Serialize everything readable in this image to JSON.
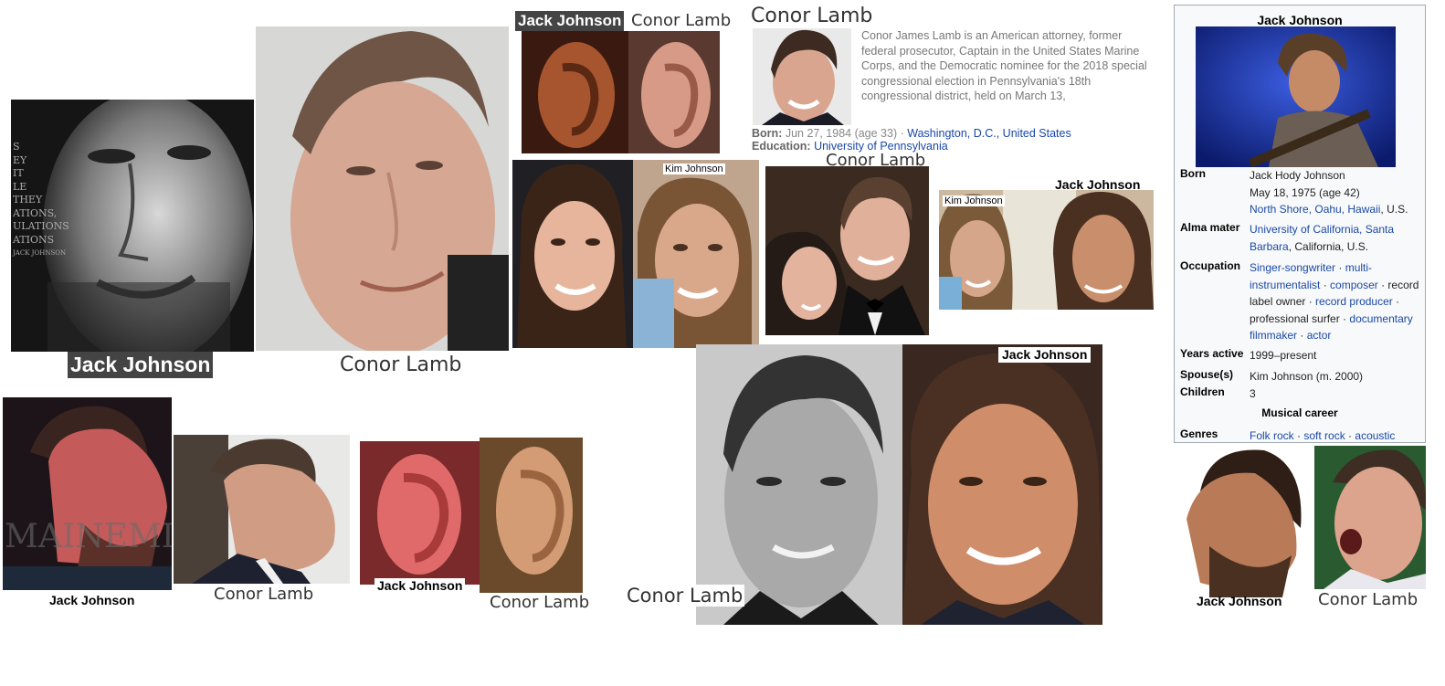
{
  "labels": {
    "jack": "Jack Johnson",
    "conor": "Conor Lamb",
    "kim": "Kim Johnson"
  },
  "album_text": [
    "S",
    "EY",
    "IT",
    "LE",
    "THEY",
    "ATIONS,",
    "ULATIONS",
    "ATIONS",
    "JACK JOHNSON"
  ],
  "watermark": "MAINEMI",
  "knowledge_panel": {
    "title": "Conor Lamb",
    "description": "Conor James Lamb is an American attorney, former federal prosecutor, Captain in the United States Marine Corps, and the Democratic nominee for the 2018 special congressional election in Pennsylvania's 18th congressional district, held on March 13,",
    "born_label": "Born:",
    "born_value": "Jun 27, 1984 (age 33) ·",
    "born_place": "Washington, D.C., United States",
    "education_label": "Education:",
    "education_value": "University of Pennsylvania"
  },
  "infobox": {
    "title": "Jack Johnson",
    "born_label": "Born",
    "born_name": "Jack Hody Johnson",
    "born_date": "May 18, 1975 (age 42)",
    "born_place_links": "North Shore, Oahu, Hawaii",
    "born_place_tail": ", U.S.",
    "alma_label": "Alma mater",
    "alma_link": "University of California, Santa Barbara",
    "alma_tail": ", California, U.S.",
    "occupation_label": "Occupation",
    "occupation": [
      {
        "text": "Singer-songwriter",
        "link": true
      },
      {
        "text": "multi-instrumentalist",
        "link": true
      },
      {
        "text": "composer",
        "link": true
      },
      {
        "text": "record label owner",
        "link": false
      },
      {
        "text": "record producer",
        "link": true
      },
      {
        "text": "professional surfer",
        "link": false
      },
      {
        "text": "documentary filmmaker",
        "link": true
      },
      {
        "text": "actor",
        "link": true
      }
    ],
    "years_label": "Years active",
    "years_value": "1999–present",
    "spouse_label": "Spouse(s)",
    "spouse_value": "Kim Johnson (m. 2000)",
    "children_label": "Children",
    "children_value": "3",
    "section": "Musical career",
    "genres_label": "Genres",
    "genres": [
      "Folk rock",
      "soft rock",
      "acoustic"
    ]
  },
  "colors": {
    "link": "#1a48a8",
    "infobox_bg": "#f8f9fa",
    "infobox_border": "#a2a9b1",
    "caption_dark": "#444444"
  }
}
